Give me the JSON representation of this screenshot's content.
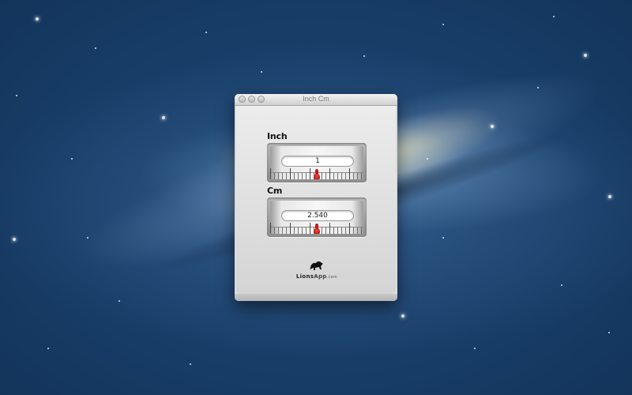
{
  "window": {
    "title": "Inch Cm"
  },
  "converter": {
    "inch": {
      "label": "Inch",
      "value": "1"
    },
    "cm": {
      "label": "Cm",
      "value": "2.540"
    }
  },
  "branding": {
    "logo_name_part1": "Lions",
    "logo_name_part2": "App",
    "logo_suffix": ".com"
  },
  "colors": {
    "needle": "#c11a1a",
    "desktop_blue": "#163a63"
  }
}
